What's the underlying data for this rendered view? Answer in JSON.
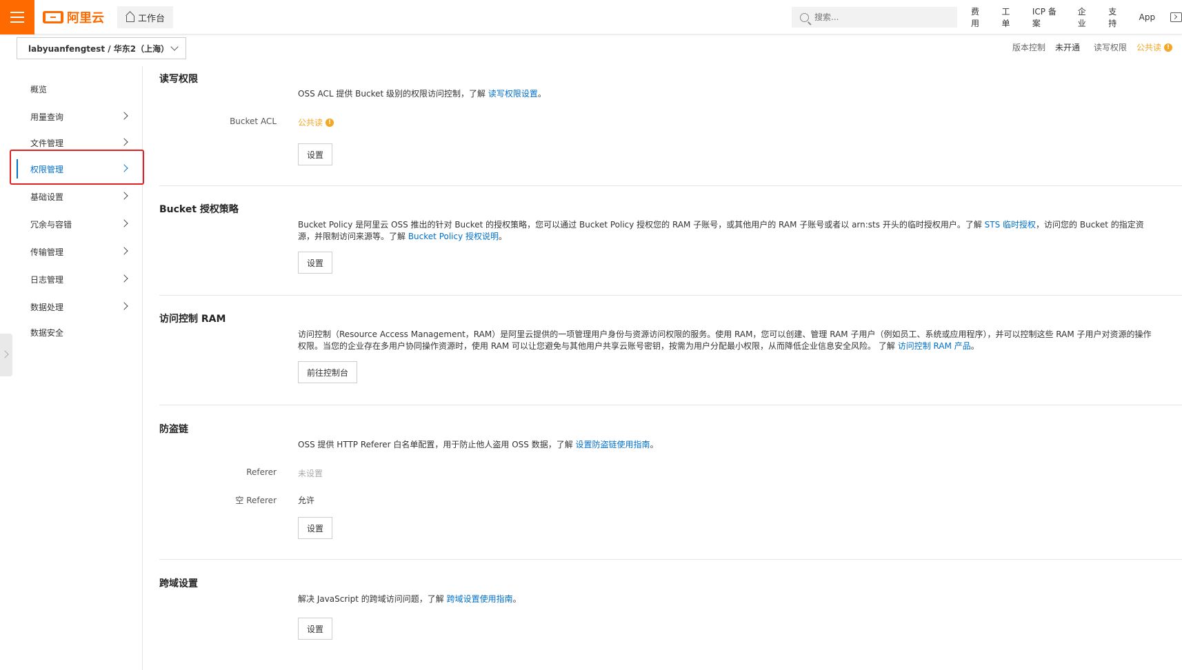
{
  "topbar": {
    "logo_text": "阿里云",
    "workbench_label": "工作台",
    "search_placeholder": "搜索...",
    "links": [
      "费用",
      "工单",
      "ICP 备案",
      "企业",
      "支持",
      "App"
    ]
  },
  "bucket": {
    "selector_label": "labyuanfengtest / 华东2（上海）",
    "version_control_label": "版本控制",
    "version_control_value": "未开通",
    "acl_label": "读写权限",
    "acl_value": "公共读"
  },
  "sidebar": {
    "items": [
      {
        "label": "概览",
        "has_chevron": false
      },
      {
        "label": "用量查询",
        "has_chevron": true
      },
      {
        "label": "文件管理",
        "has_chevron": true
      },
      {
        "label": "权限管理",
        "has_chevron": true,
        "active": true
      },
      {
        "label": "基础设置",
        "has_chevron": true
      },
      {
        "label": "冗余与容错",
        "has_chevron": true
      },
      {
        "label": "传输管理",
        "has_chevron": true
      },
      {
        "label": "日志管理",
        "has_chevron": true
      },
      {
        "label": "数据处理",
        "has_chevron": true
      },
      {
        "label": "数据安全",
        "has_chevron": false
      }
    ]
  },
  "sections": {
    "acl": {
      "title": "读写权限",
      "desc_prefix": "OSS ACL 提供 Bucket 级别的权限访问控制，了解 ",
      "desc_link": "读写权限设置",
      "desc_suffix": "。",
      "row_label": "Bucket ACL",
      "row_value": "公共读",
      "button": "设置"
    },
    "policy": {
      "title": "Bucket 授权策略",
      "desc_part1": "Bucket Policy 是阿里云 OSS 推出的针对 Bucket 的授权策略，您可以通过 Bucket Policy 授权您的 RAM 子账号，或其他用户的 RAM 子账号或者以 arn:sts 开头的临时授权用户。了解 ",
      "desc_link1": "STS 临时授权",
      "desc_part2": "，访问您的 Bucket 的指定资源，并限制访问来源等。了解 ",
      "desc_link2": "Bucket Policy 授权说明",
      "desc_suffix": "。",
      "button": "设置"
    },
    "ram": {
      "title": "访问控制 RAM",
      "desc_part1": "访问控制（Resource Access Management，RAM）是阿里云提供的一项管理用户身份与资源访问权限的服务。使用 RAM，您可以创建、管理 RAM 子用户（例如员工、系统或应用程序），并可以控制这些 RAM 子用户对资源的操作权限。当您的企业存在多用户协同操作资源时，使用 RAM 可以让您避免与其他用户共享云账号密钥，按需为用户分配最小权限，从而降低企业信息安全风险。 了解 ",
      "desc_link": "访问控制 RAM 产品",
      "desc_suffix": "。",
      "button": "前往控制台"
    },
    "referer": {
      "title": "防盗链",
      "desc_prefix": "OSS 提供 HTTP Referer 白名单配置，用于防止他人盗用 OSS 数据，了解 ",
      "desc_link": "设置防盗链使用指南",
      "desc_suffix": "。",
      "row1_label": "Referer",
      "row1_value": "未设置",
      "row2_label": "空 Referer",
      "row2_value": "允许",
      "button": "设置"
    },
    "cors": {
      "title": "跨域设置",
      "desc_prefix": "解决 JavaScript 的跨域访问问题，了解 ",
      "desc_link": "跨域设置使用指南",
      "desc_suffix": "。",
      "button": "设置"
    }
  },
  "colors": {
    "brand": "#ff6a00",
    "link": "#0070cc",
    "warning": "#f5a623",
    "highlight": "#e02020"
  }
}
